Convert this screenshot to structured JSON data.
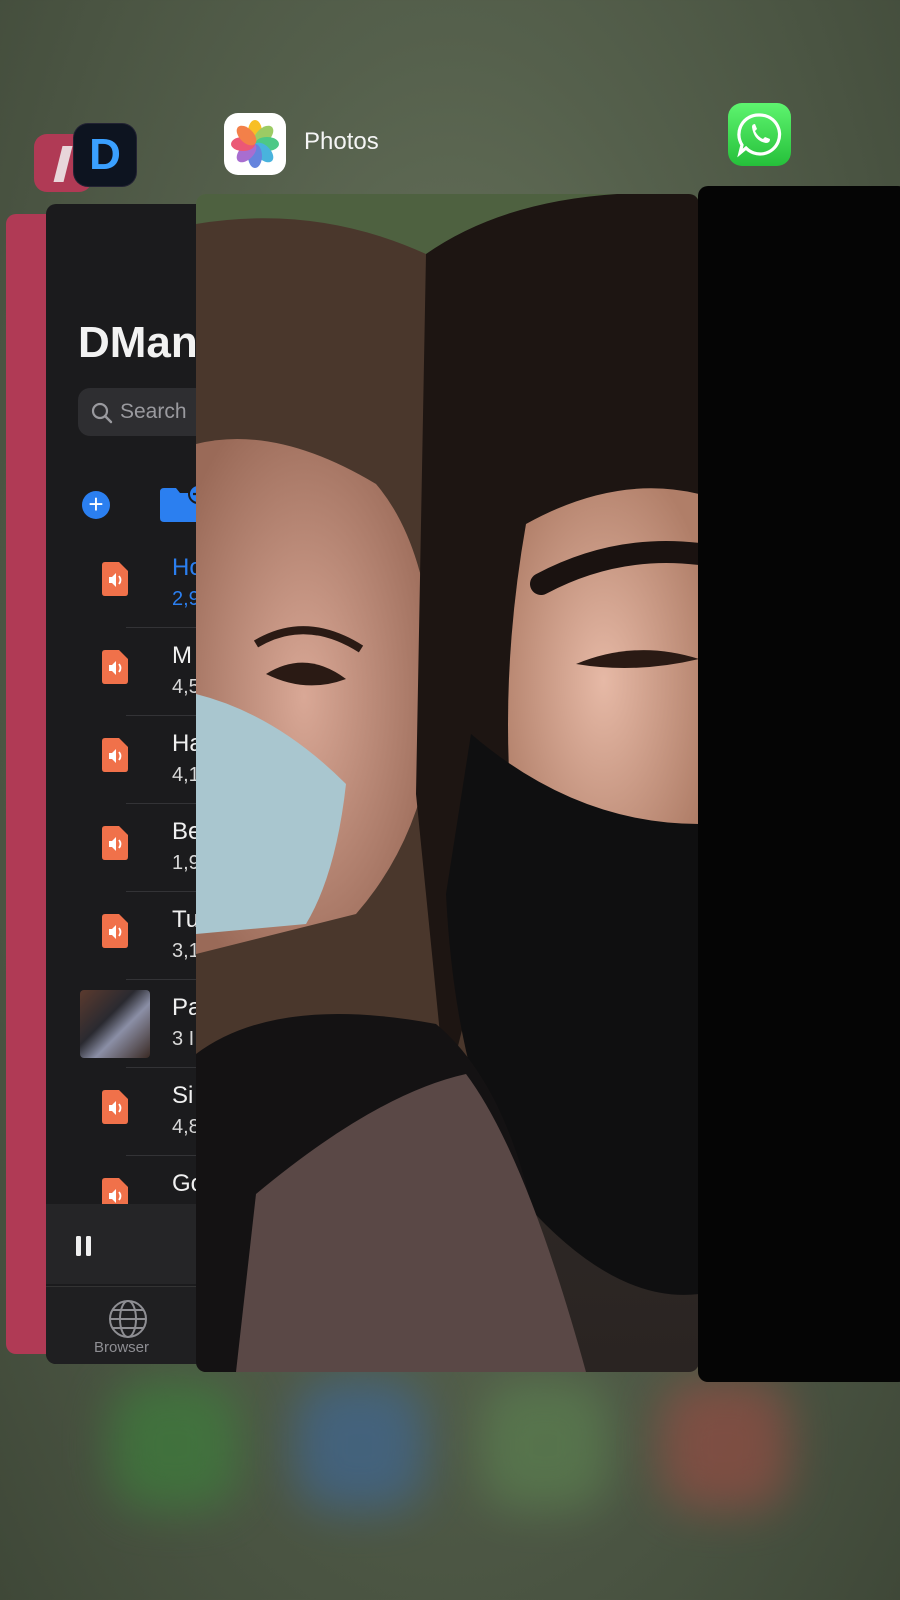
{
  "switcher": {
    "photos_label": "Photos"
  },
  "dmanager": {
    "title": "DMan",
    "search_placeholder": "Search",
    "rows": [
      {
        "name": "Ho",
        "sub": "2,9",
        "active": true,
        "type": "audio"
      },
      {
        "name": "M",
        "sub": "4,5",
        "active": false,
        "type": "audio"
      },
      {
        "name": "Ha",
        "sub": "4,1",
        "active": false,
        "type": "audio"
      },
      {
        "name": "Be",
        "sub": "1,9",
        "active": false,
        "type": "audio"
      },
      {
        "name": "Tu",
        "sub": "3,1",
        "active": false,
        "type": "audio"
      },
      {
        "name": "Pa",
        "sub": "3 I",
        "active": false,
        "type": "video"
      },
      {
        "name": "Si",
        "sub": "4,8",
        "active": false,
        "type": "audio"
      },
      {
        "name": "Go",
        "sub": "",
        "active": false,
        "type": "audio"
      }
    ],
    "tab_browser": "Browser"
  },
  "colors": {
    "accent_blue": "#2b7ff0",
    "file_orange": "#f0714a",
    "card_red": "#b03a55"
  },
  "icons": [
    "dmanager-app-icon",
    "photos-app-icon",
    "whatsapp-app-icon",
    "search-icon",
    "add-icon",
    "folder-add-icon",
    "audio-file-icon",
    "pause-icon",
    "globe-icon"
  ]
}
